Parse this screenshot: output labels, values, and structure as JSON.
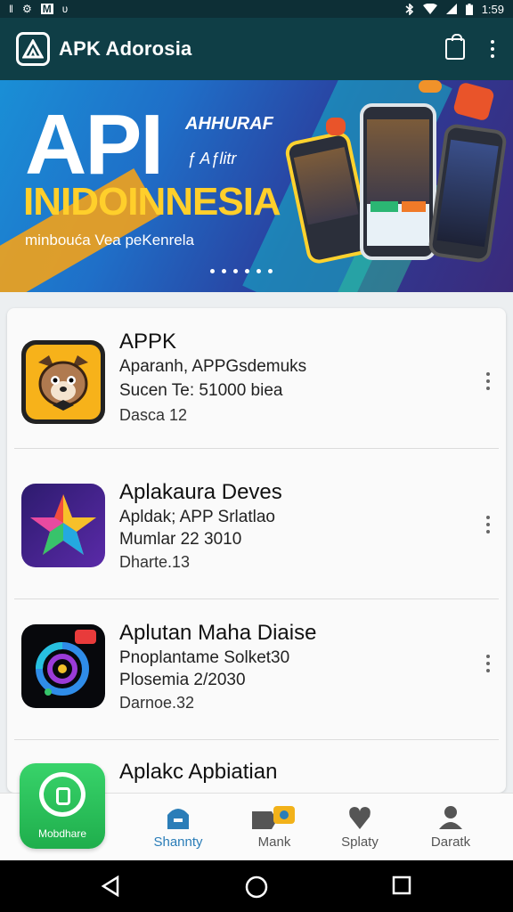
{
  "status_bar": {
    "time": "1:59",
    "notif_left": [
      "ǁ",
      "⚙",
      "M",
      "ʋ"
    ]
  },
  "app_bar": {
    "title": "APK Adorosia"
  },
  "banner": {
    "headline": "API",
    "tag1": "AHHURAF",
    "tag2": "ƒ Aƒlitr",
    "title": "INIDOINNESIA",
    "subtitle": "minbouća Vea peKenrela",
    "colors": {
      "title": "#ffcf2b",
      "accent_orange": "#f2a21b",
      "accent_teal": "#16b7c9"
    }
  },
  "apps": [
    {
      "name": "APPK",
      "line1": "Aparanh, APPGsdemuks",
      "line2": "Sucen Te: 51000 biea",
      "line3": "Dasca 12",
      "icon": "raccoon-icon"
    },
    {
      "name": "Aplakaura Deves",
      "line1": "Apldak; APP Srlatlao",
      "line2": "Mumlar 22 3010",
      "line3": "Dharte.13",
      "icon": "star-icon"
    },
    {
      "name": "Aplutan Maha Diaise",
      "line1": "Pnoplantame Solket30",
      "line2": "Plosemia 2/2030",
      "line3": "Darnoe.32",
      "icon": "ring-logo-icon"
    },
    {
      "name": "Aplakc Apbiatian",
      "line1": "",
      "line2": "",
      "line3": "",
      "icon": "chat-bubble-icon"
    }
  ],
  "bottom_nav": {
    "home_label": "Mobdhare",
    "items": [
      {
        "label": "Shannty",
        "icon": "store-icon",
        "active": true
      },
      {
        "label": "Mank",
        "icon": "media-icon",
        "active": false
      },
      {
        "label": "Splaty",
        "icon": "heart-shield-icon",
        "active": false
      },
      {
        "label": "Daratk",
        "icon": "person-icon",
        "active": false
      }
    ]
  },
  "system_nav": [
    "back-icon",
    "home-icon",
    "recents-icon"
  ]
}
